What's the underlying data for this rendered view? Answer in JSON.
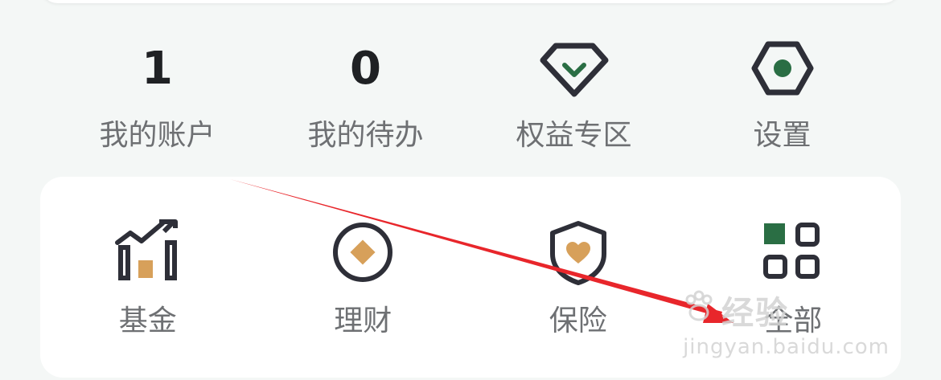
{
  "stats": [
    {
      "value": "1",
      "label": "我的账户"
    },
    {
      "value": "0",
      "label": "我的待办"
    },
    {
      "label": "权益专区",
      "icon": "diamond-icon"
    },
    {
      "label": "设置",
      "icon": "settings-hexagon-icon"
    }
  ],
  "services": [
    {
      "label": "基金",
      "icon": "fund-chart-icon"
    },
    {
      "label": "理财",
      "icon": "wealth-diamond-icon"
    },
    {
      "label": "保险",
      "icon": "shield-heart-icon"
    },
    {
      "label": "全部",
      "icon": "grid-apps-icon"
    }
  ],
  "watermark": {
    "brand": "经验",
    "site": "jingyan.baidu.com"
  },
  "colors": {
    "accent_green": "#2a6e44",
    "accent_orange": "#d7a05a",
    "icon_dark": "#2e2f38",
    "annotation_red": "#e8262b"
  }
}
